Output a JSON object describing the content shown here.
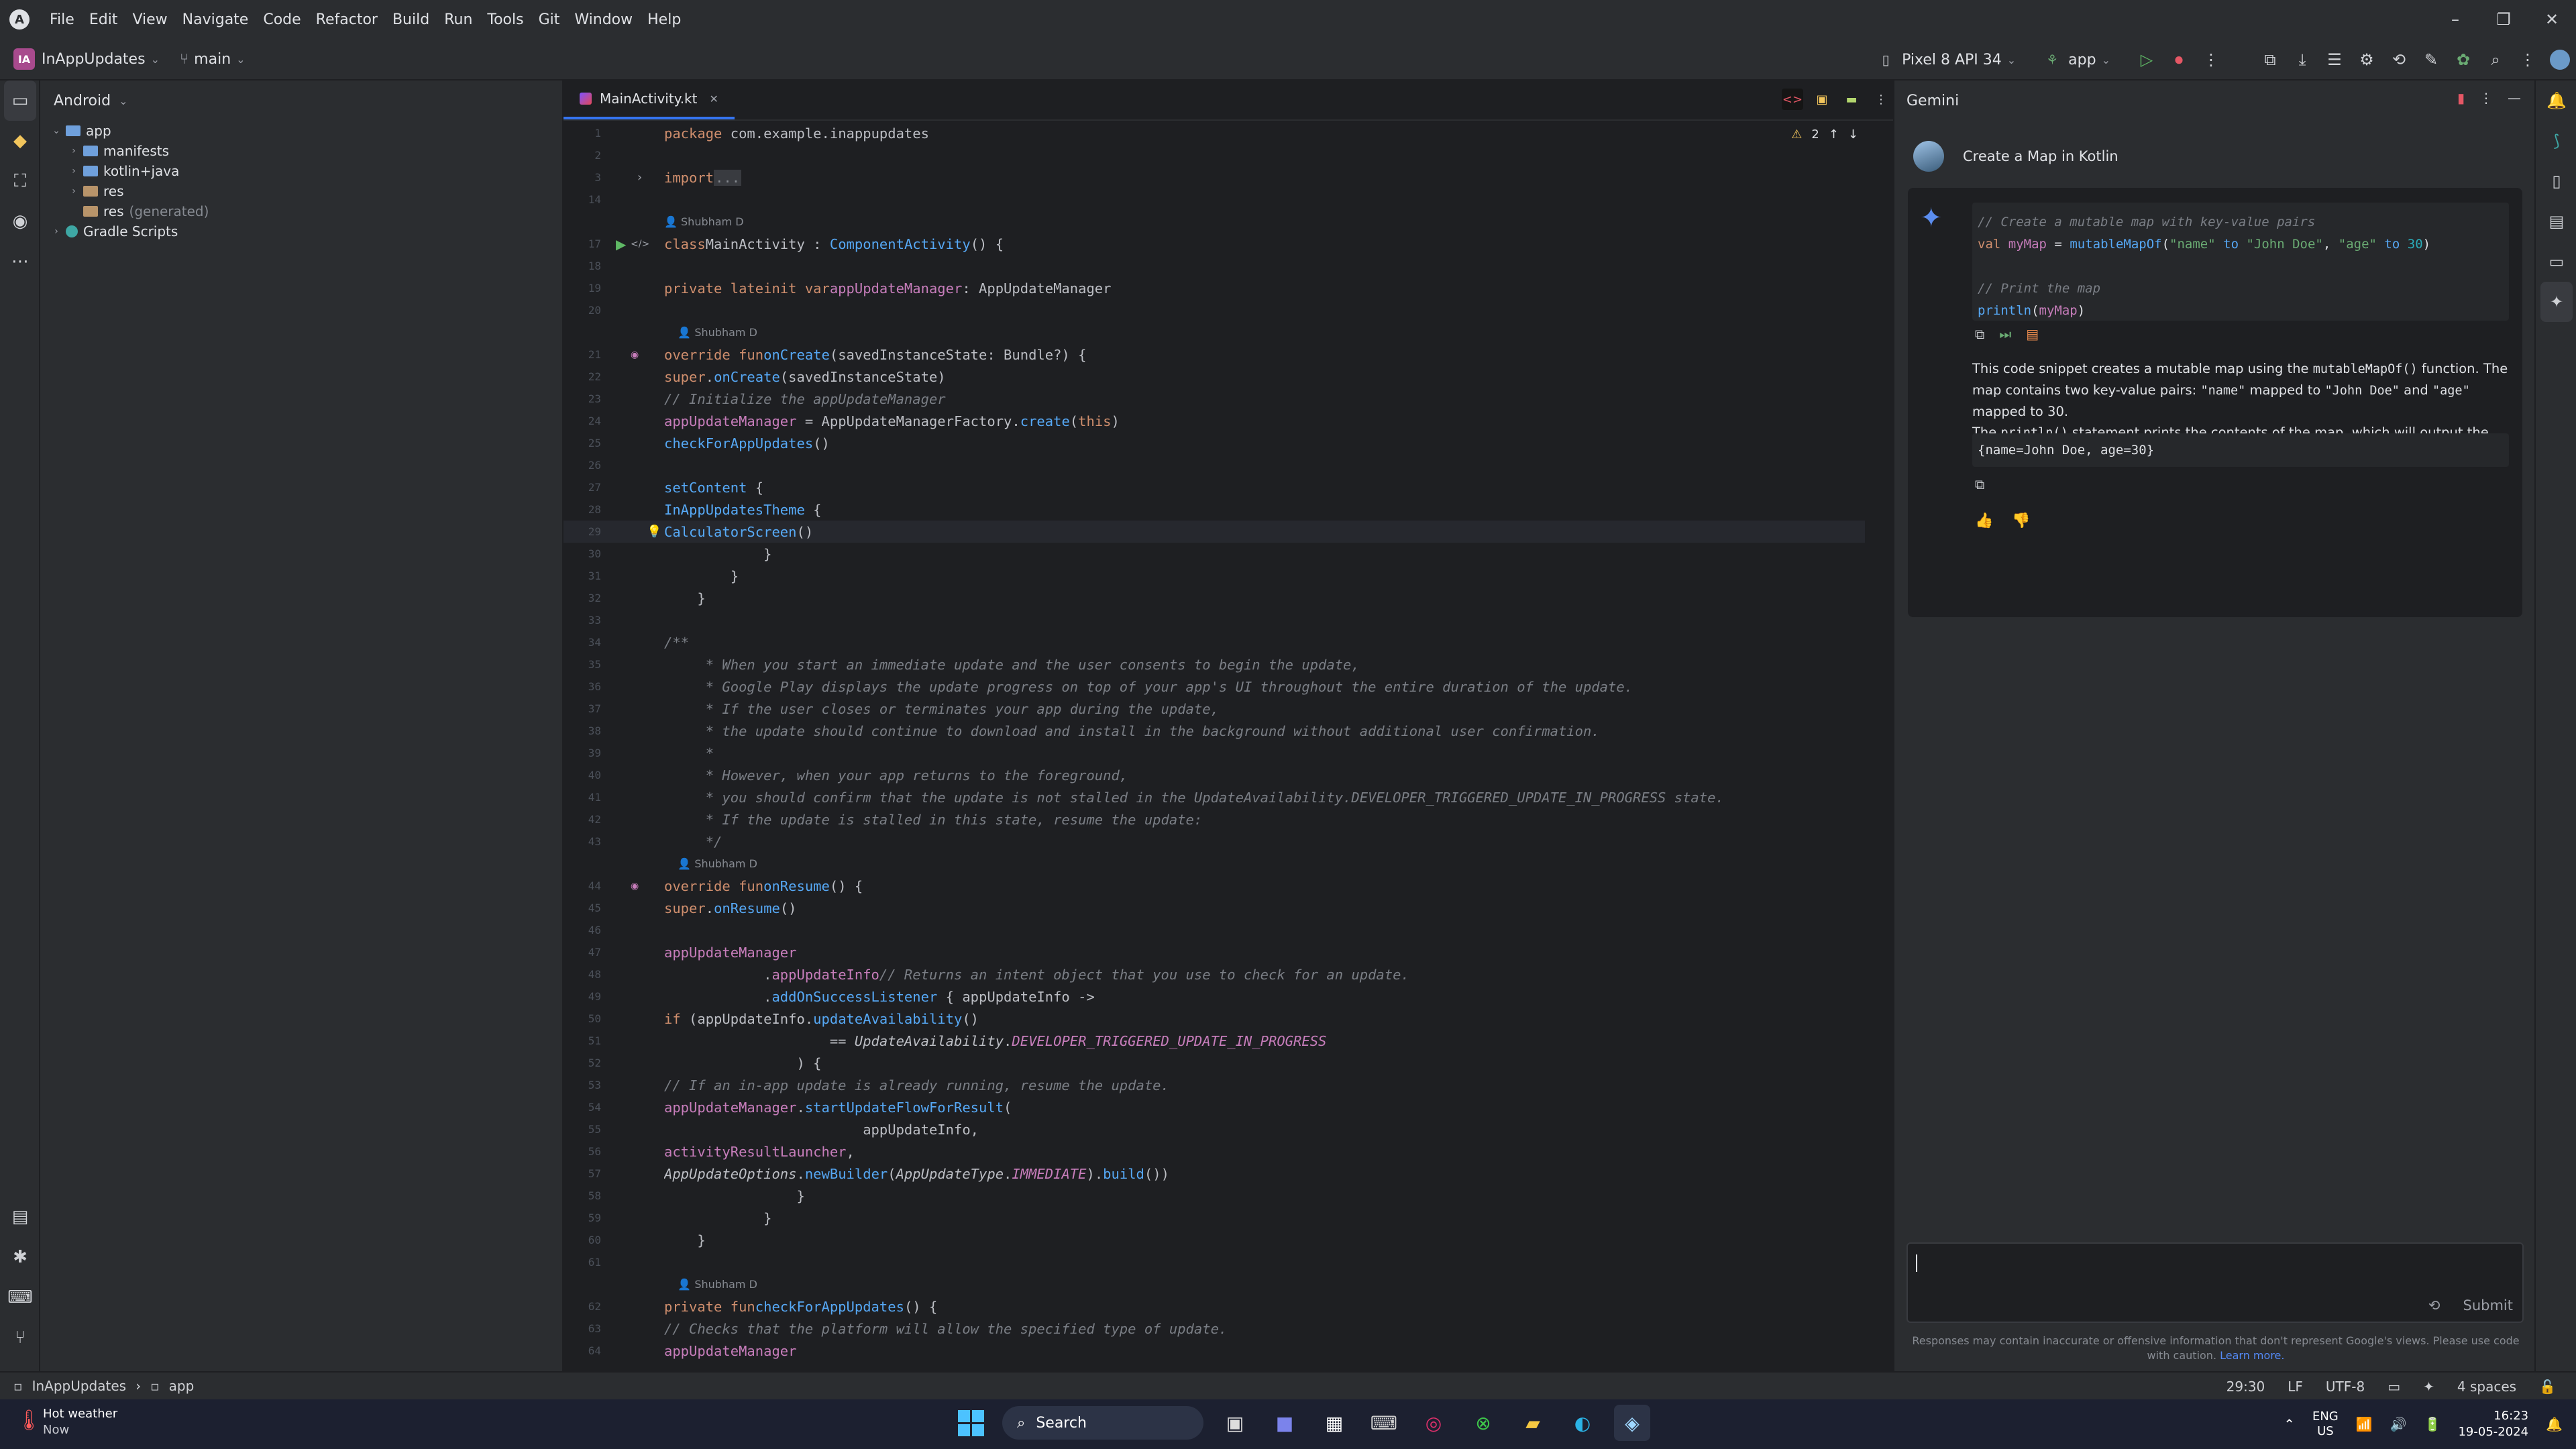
{
  "menubar": {
    "items": [
      "File",
      "Edit",
      "View",
      "Navigate",
      "Code",
      "Refactor",
      "Build",
      "Run",
      "Tools",
      "Git",
      "Window",
      "Help"
    ]
  },
  "toolbar": {
    "project_badge": "IA",
    "project_name": "InAppUpdates",
    "branch": "main",
    "device": "Pixel 8 API 34",
    "run_config": "app"
  },
  "project_panel": {
    "view_name": "Android",
    "tree": [
      {
        "label": "app",
        "level": 0,
        "expanded": true
      },
      {
        "label": "manifests",
        "level": 1
      },
      {
        "label": "kotlin+java",
        "level": 1
      },
      {
        "label": "res",
        "level": 1
      },
      {
        "label": "res",
        "suffix": "(generated)",
        "level": 1
      },
      {
        "label": "Gradle Scripts",
        "level": 0
      }
    ]
  },
  "editor": {
    "tab": "MainActivity.kt",
    "warnings": "2",
    "authors": {
      "a1": "Shubham D",
      "a2": "Shubham D",
      "a3": "Shubham D",
      "a4": "Shubham D"
    },
    "line_numbers": [
      "1",
      "2",
      "3",
      "14",
      "",
      "17",
      "18",
      "19",
      "20",
      "",
      "21",
      "22",
      "23",
      "24",
      "25",
      "26",
      "27",
      "28",
      "29",
      "30",
      "31",
      "32",
      "33",
      "34",
      "35",
      "36",
      "37",
      "38",
      "39",
      "40",
      "41",
      "42",
      "43",
      "",
      "44",
      "45",
      "46",
      "47",
      "48",
      "49",
      "50",
      "51",
      "52",
      "53",
      "54",
      "55",
      "56",
      "57",
      "58",
      "59",
      "60",
      "61",
      "",
      "62",
      "63",
      "64"
    ]
  },
  "gemini": {
    "title": "Gemini",
    "user_prompt": "Create a Map in Kotlin",
    "snippet": {
      "c1": "// Create a mutable map with key-value pairs",
      "c2": "// Print the map"
    },
    "para1_a": "This code snippet creates a mutable map using the ",
    "para1_code": "mutableMapOf()",
    "para1_b": " function. The map contains two key-value pairs: ",
    "k1": "\"name\"",
    "mapped1": " mapped to ",
    "v1": "\"John Doe\"",
    "and": " and ",
    "k2": "\"age\"",
    "mapped2": " mapped to 30.",
    "para2_a": "The ",
    "para2_code": "println()",
    "para2_b": " statement prints the contents of the map, which will output the following:",
    "output": "{name=John Doe, age=30}",
    "submit": "Submit",
    "disclaimer": "Responses may contain inaccurate or offensive information that don't represent Google's views. Please use code with caution.",
    "learn_more": "Learn more."
  },
  "statusbar": {
    "crumb1": "InAppUpdates",
    "crumb2": "app",
    "position": "29:30",
    "line_sep": "LF",
    "encoding": "UTF-8",
    "indent": "4 spaces"
  },
  "taskbar": {
    "weather_title": "Hot weather",
    "weather_sub": "Now",
    "search": "Search",
    "lang1": "ENG",
    "lang2": "US",
    "time": "16:23",
    "date": "19-05-2024"
  },
  "colors": {
    "accent": "#3574f0",
    "keyword": "#cf8e6d",
    "function": "#56a8f5",
    "string": "#6aab73",
    "comment": "#7a7e85"
  }
}
